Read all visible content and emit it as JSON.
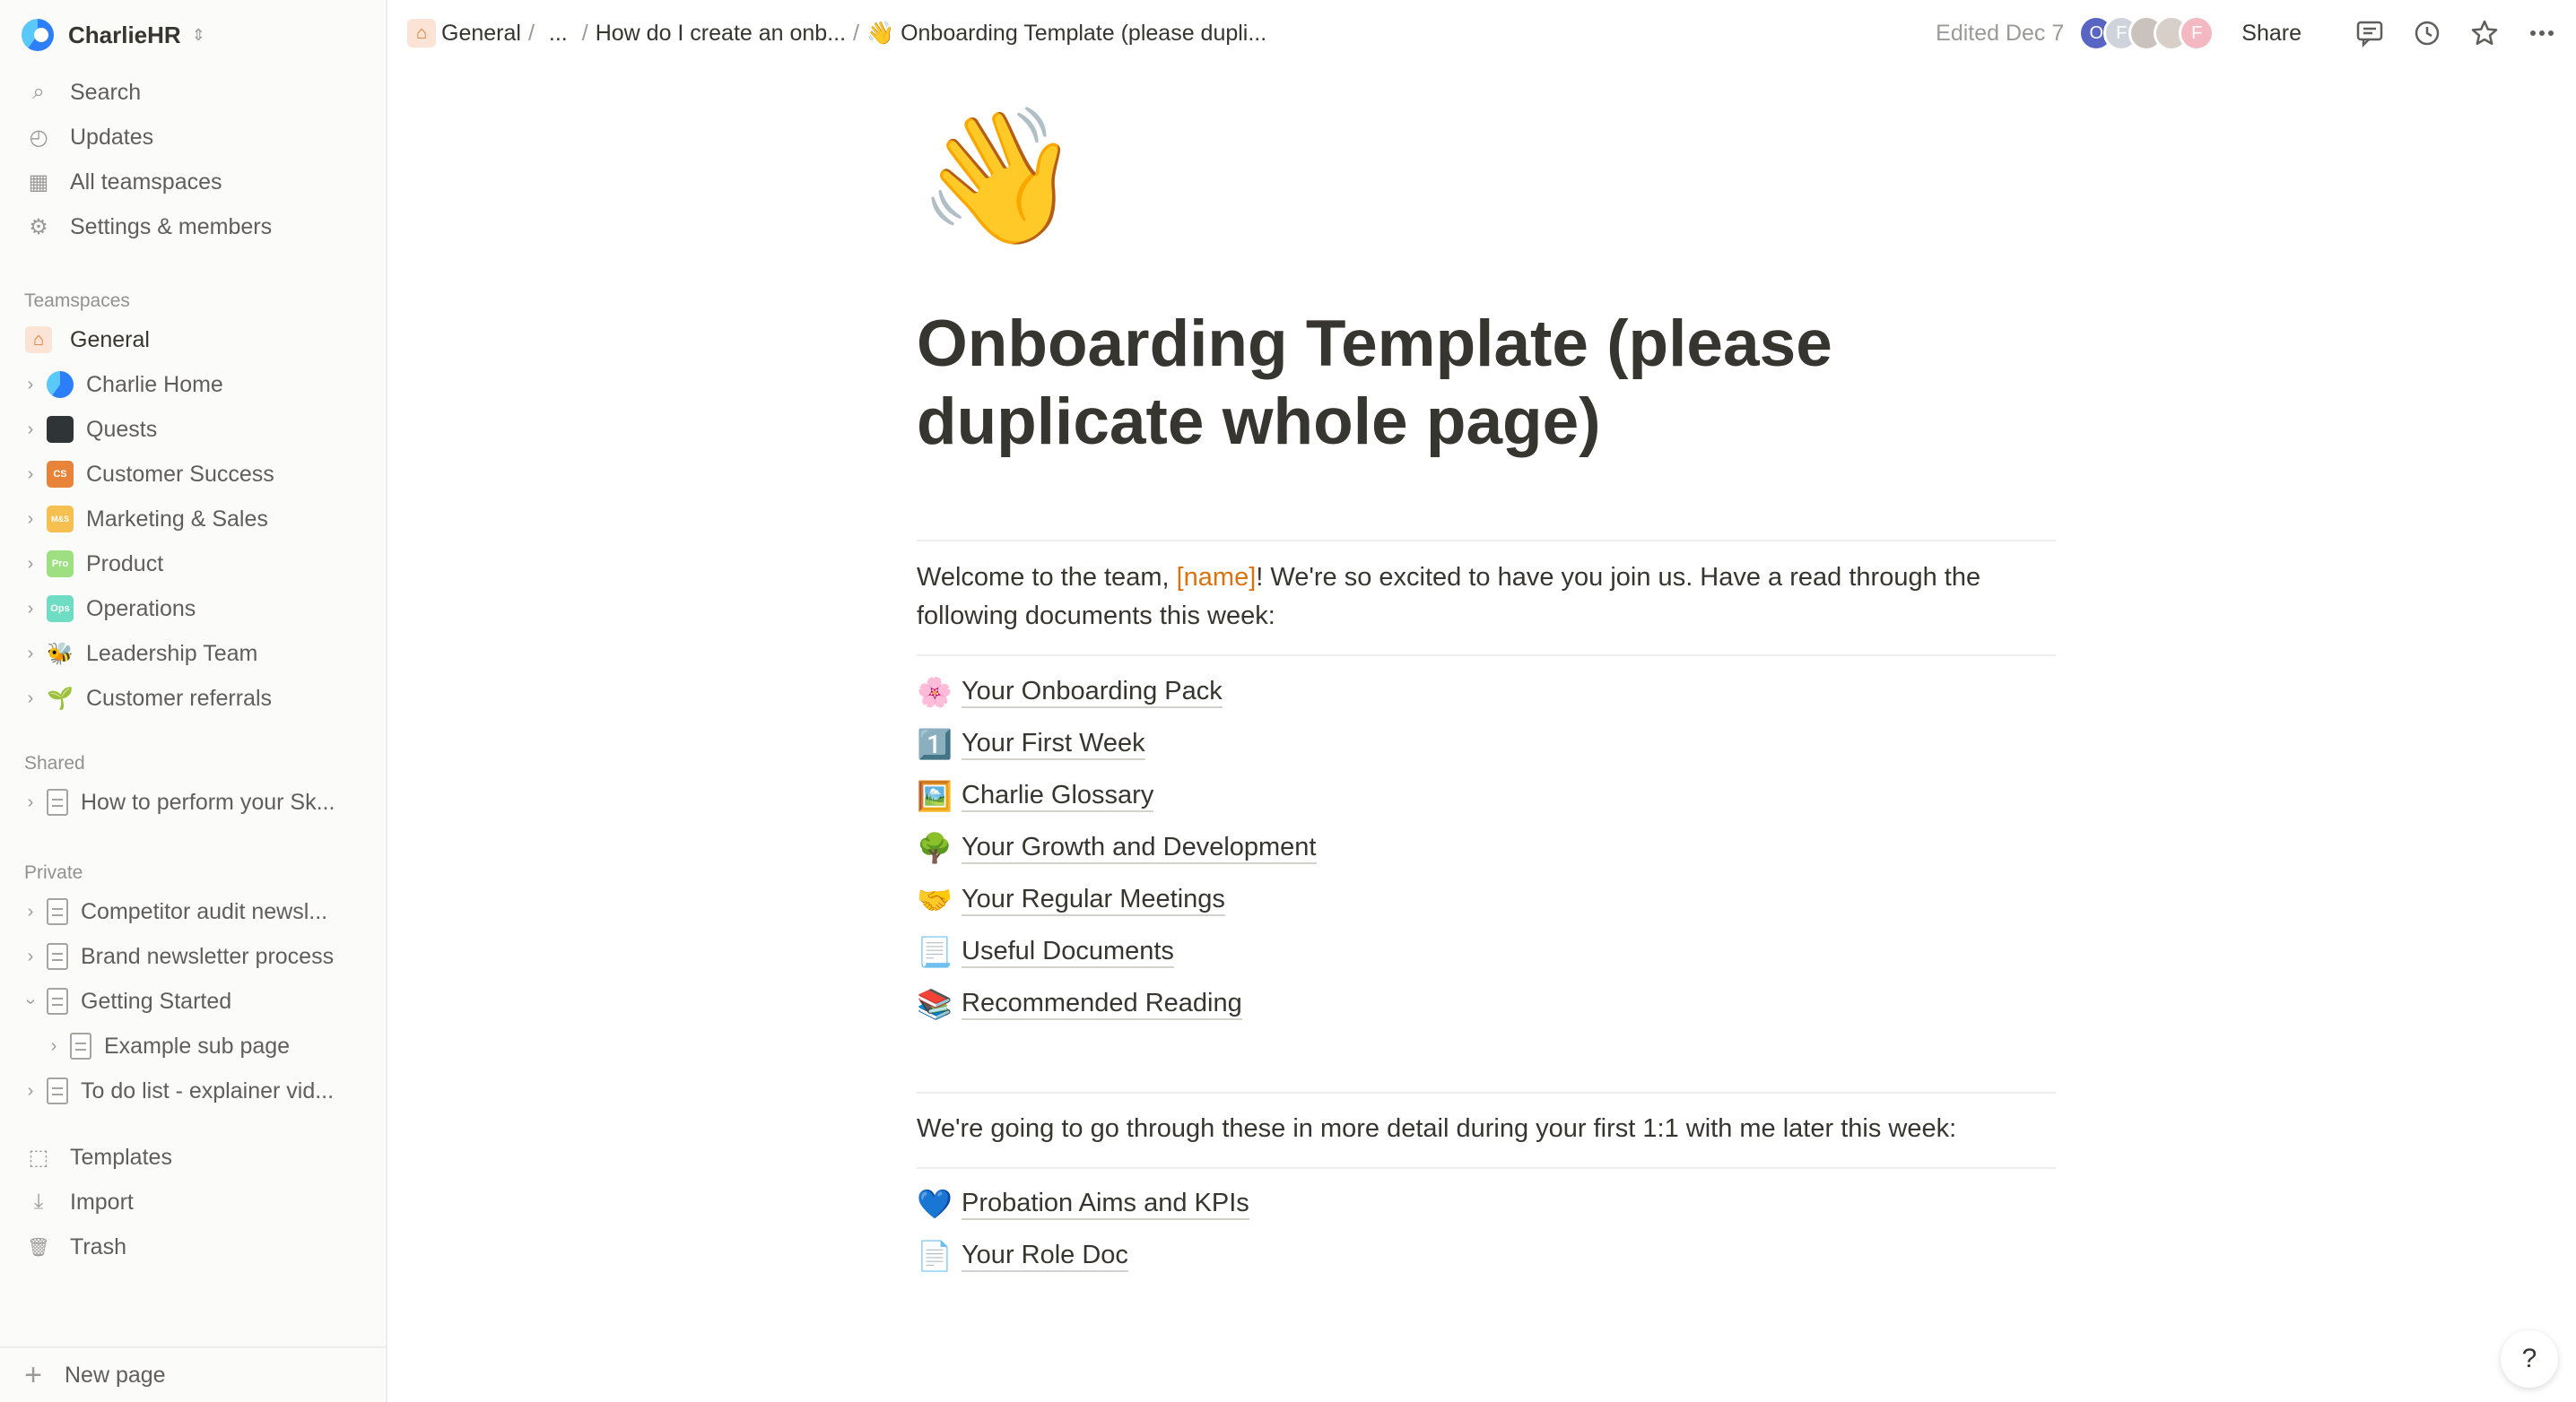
{
  "workspace": {
    "name": "CharlieHR"
  },
  "nav": [
    {
      "label": "Search",
      "icon": "search-icon",
      "glyph": "⌕"
    },
    {
      "label": "Updates",
      "icon": "clock-icon",
      "glyph": "◴"
    },
    {
      "label": "All teamspaces",
      "icon": "building-icon",
      "glyph": "▦"
    },
    {
      "label": "Settings & members",
      "icon": "gear-icon",
      "glyph": "⚙"
    }
  ],
  "sections": {
    "teamspaces": "Teamspaces",
    "shared": "Shared",
    "private": "Private"
  },
  "teamspaces": [
    {
      "label": "General",
      "badge": "",
      "color": "#fbe4d5"
    },
    {
      "label": "Charlie Home",
      "badge": "",
      "color": "#2d7ff9"
    },
    {
      "label": "Quests",
      "badge": "",
      "color": "#2f3437"
    },
    {
      "label": "Customer Success",
      "badge": "CS",
      "color": "#e8833a"
    },
    {
      "label": "Marketing & Sales",
      "badge": "M&S",
      "color": "#f5c04f"
    },
    {
      "label": "Product",
      "badge": "Pro",
      "color": "#9ee081"
    },
    {
      "label": "Operations",
      "badge": "Ops",
      "color": "#6fdcc4"
    },
    {
      "label": "Leadership Team",
      "badge": "🐝",
      "color": "transparent"
    },
    {
      "label": "Customer referrals",
      "badge": "🌱",
      "color": "transparent"
    }
  ],
  "shared": [
    {
      "label": "How to perform your Sk..."
    }
  ],
  "private": [
    {
      "label": "Competitor audit newsl..."
    },
    {
      "label": "Brand newsletter process"
    },
    {
      "label": "Getting Started"
    },
    {
      "label": "Example sub page"
    },
    {
      "label": "To do list - explainer vid..."
    }
  ],
  "bottom_nav": [
    {
      "label": "Templates",
      "icon": "templates-icon",
      "glyph": "⬚"
    },
    {
      "label": "Import",
      "icon": "import-icon",
      "glyph": "⤓"
    },
    {
      "label": "Trash",
      "icon": "trash-icon",
      "glyph": "🗑"
    }
  ],
  "new_page": "New page",
  "breadcrumb": {
    "items": [
      "General",
      "...",
      "How do I create an onb...",
      "👋 Onboarding Template (please dupli..."
    ],
    "sep": "/"
  },
  "topbar": {
    "edited": "Edited Dec 7",
    "share": "Share",
    "avatars": [
      {
        "letter": "O",
        "color": "#5865c2"
      },
      {
        "letter": "F",
        "color": "#cfd3db"
      },
      {
        "letter": "",
        "color": "#c9c2bd"
      },
      {
        "letter": "",
        "color": "#d8cfc9"
      },
      {
        "letter": "F",
        "color": "#f3b8c2"
      }
    ]
  },
  "page": {
    "emoji": "👋",
    "title": "Onboarding Template (please duplicate whole page)",
    "intro_before": "Welcome to the team, ",
    "intro_tag": "[name]",
    "intro_after": "! We're so excited to have you join us. Have a read through the following documents this week:",
    "links_1": [
      {
        "emoji": "🌸",
        "label": "Your Onboarding Pack"
      },
      {
        "emoji": "1️⃣",
        "label": "Your First Week"
      },
      {
        "emoji": "🖼️",
        "label": "Charlie Glossary"
      },
      {
        "emoji": "🌳",
        "label": "Your Growth and Development"
      },
      {
        "emoji": "🤝",
        "label": "Your Regular Meetings"
      },
      {
        "emoji": "📃",
        "label": "Useful Documents"
      },
      {
        "emoji": "📚",
        "label": "Recommended Reading"
      }
    ],
    "para_2": "We're going to go through these in more detail during your first 1:1 with me later this week:",
    "links_2": [
      {
        "emoji": "💙",
        "label": "Probation Aims and KPIs"
      },
      {
        "emoji": "📄",
        "label": "Your Role Doc"
      }
    ]
  },
  "help": "?"
}
